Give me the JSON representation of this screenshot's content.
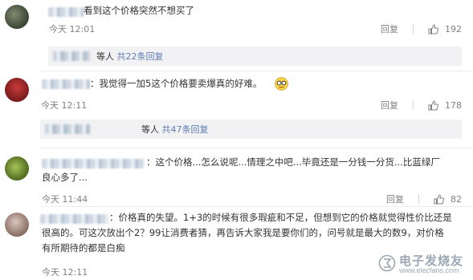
{
  "comments": [
    {
      "text_lines": [
        "看到这个价格突然不想买了"
      ],
      "time": "今天 12:01",
      "reply_label": "回复",
      "likes": "192",
      "reply_summary": {
        "prefix": "等人",
        "link": "共22条回复"
      }
    },
    {
      "text_lines": [
        "：我觉得一加5这个价格要卖爆真的好难。"
      ],
      "time": "今天 12:11",
      "reply_label": "回复",
      "likes": "178",
      "reply_summary": {
        "prefix": "等人",
        "link": "共47条回复"
      }
    },
    {
      "text_lines": [
        "：这个价格...怎么说呢...情理之中吧...毕竟还是一分钱一分货...比蓝绿厂",
        "良心多了..."
      ],
      "time": "今天 11:44",
      "reply_label": "回复",
      "likes": "82"
    },
    {
      "text_lines": [
        "：价格真的失望。1+3的时候有很多瑕疵和不足，但想到它的价格就觉得性价比还是",
        "很高的。可这次放出个2？99让消费者猜，再告诉大家我是要你们的，问号就是最大的数9，对价格",
        "有所期待的都是白痴"
      ],
      "time": "今天 12:11"
    }
  ],
  "watermark": {
    "text": "电子发烧友",
    "sub": "www.elecfans.com"
  }
}
